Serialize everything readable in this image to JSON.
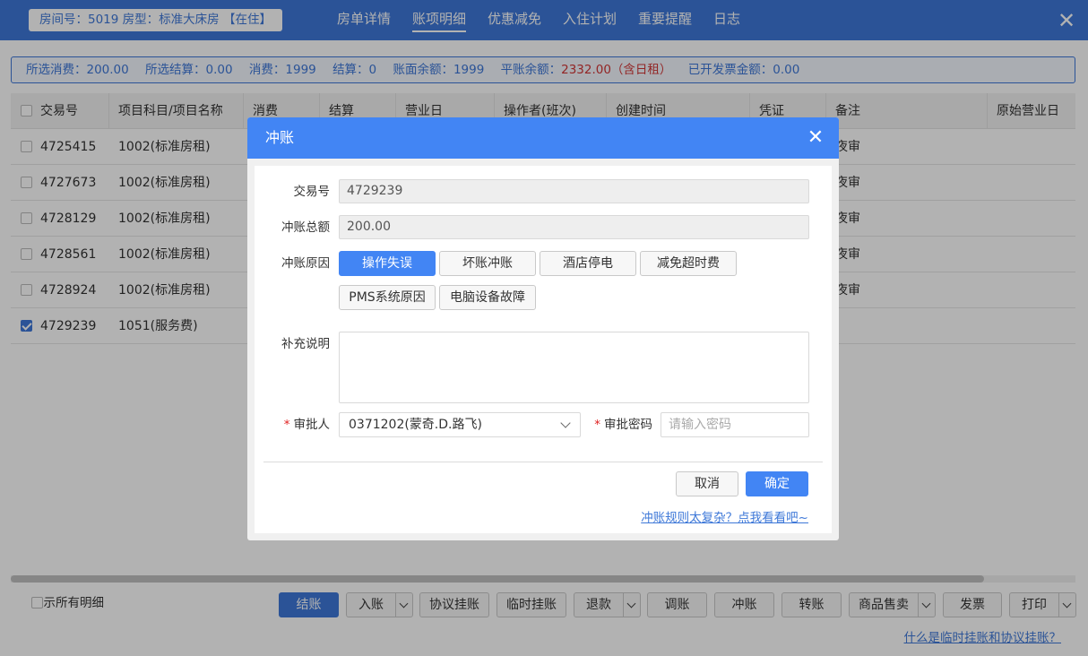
{
  "header": {
    "room_info": "房间号：5019 房型：标准大床房 【在住】",
    "tabs": [
      "房单详情",
      "账项明细",
      "优惠减免",
      "入住计划",
      "重要提醒",
      "日志"
    ],
    "active_tab": "账项明细",
    "close_icon": "close-icon"
  },
  "summary": {
    "selected_consume": "所选消费：200.00",
    "selected_settle": "所选结算：0.00",
    "consume": "消费：1999",
    "settle": "结算：0",
    "book_balance": "账面余额：1999",
    "flat_balance_label": "平账余额：",
    "flat_balance_value": "2332.00（含日租）",
    "invoiced": "已开发票金额：0.00",
    "accent_color": "#3e78d8",
    "alert_color": "#d23636"
  },
  "table": {
    "headers": {
      "txn": "交易号",
      "item": "项目科目/项目名称",
      "consume": "消费",
      "settle": "结算",
      "bizdate": "营业日",
      "operator": "操作者(班次)",
      "created": "创建时间",
      "voucher": "凭证",
      "remark": "备注",
      "orig_bizdate": "原始营业日"
    },
    "rows": [
      {
        "txn": "4725415",
        "item": "1002(标准房租)",
        "remark": "夜审",
        "checked": false
      },
      {
        "txn": "4727673",
        "item": "1002(标准房租)",
        "remark": "夜审",
        "checked": false
      },
      {
        "txn": "4728129",
        "item": "1002(标准房租)",
        "remark": "夜审",
        "checked": false
      },
      {
        "txn": "4728561",
        "item": "1002(标准房租)",
        "remark": "夜审",
        "checked": false
      },
      {
        "txn": "4728924",
        "item": "1002(标准房租)",
        "remark": "夜审",
        "checked": false
      },
      {
        "txn": "4729239",
        "item": "1051(服务费)",
        "remark": "",
        "checked": true
      }
    ]
  },
  "footer": {
    "show_all": "显示所有明细",
    "buttons": {
      "settle": "结账",
      "post": "入账",
      "agreement_hang": "协议挂账",
      "temp_hang": "临时挂账",
      "refund": "退款",
      "adjust": "调账",
      "reverse": "冲账",
      "transfer": "转账",
      "goods_sale": "商品售卖",
      "invoice": "发票",
      "print": "打印"
    },
    "help_link": "什么是临时挂账和协议挂账？"
  },
  "modal": {
    "title": "冲账",
    "txn_label": "交易号",
    "txn_value": "4729239",
    "amount_label": "冲账总额",
    "amount_value": "200.00",
    "reason_label": "冲账原因",
    "reasons": [
      "操作失误",
      "坏账冲账",
      "酒店停电",
      "减免超时费",
      "PMS系统原因",
      "电脑设备故障"
    ],
    "selected_reason": "操作失误",
    "note_label": "补充说明",
    "approver_label": "审批人",
    "approver_value": "0371202(蒙奇.D.路飞)",
    "password_label": "审批密码",
    "password_placeholder": "请输入密码",
    "cancel": "取消",
    "confirm": "确定",
    "help_link": "冲账规则太复杂？点我看看吧~"
  }
}
